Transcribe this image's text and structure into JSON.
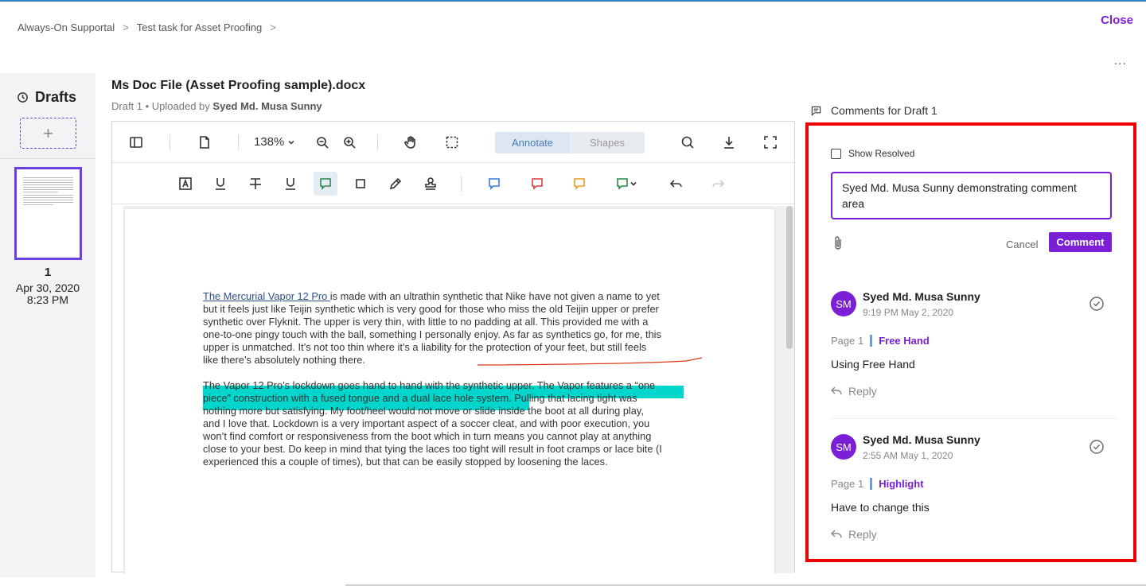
{
  "breadcrumb": {
    "items": [
      "Always-On Supportal",
      "Test task for Asset Proofing"
    ],
    "separator": ">"
  },
  "header": {
    "close_label": "Close",
    "more_label": "..."
  },
  "sidebar": {
    "title": "Drafts",
    "add_label": "+",
    "draft": {
      "number": "1",
      "date": "Apr 30, 2020",
      "time": "8:23 PM"
    }
  },
  "document": {
    "title": "Ms Doc File (Asset Proofing sample).docx",
    "subtitle_prefix": "Draft 1 • Uploaded by",
    "uploader": "Syed Md. Musa Sunny"
  },
  "toolbar": {
    "zoom": "138%",
    "mode_tabs": [
      {
        "label": "Annotate",
        "active": true
      },
      {
        "label": "Shapes",
        "active": false
      }
    ]
  },
  "page_content": {
    "para1_link": "The Mercurial Vapor 12 Pro ",
    "para1_lines": [
      "is made with an ultrathin synthetic that Nike have not given a name to yet",
      "but it feels just like Teijin synthetic which is very good for those who miss the old Teijin upper or prefer",
      "synthetic over Flyknit. The upper is very thin, with little to no padding at all. This provided me with a",
      "one-to-one pingy touch with the ball, something I personally enjoy. As far as synthetics go, for me, this",
      "upper is unmatched. It’s not too thin where it’s a liability for the protection of your feet, but still feels",
      "like there’s absolutely nothing there."
    ],
    "para2_lines": [
      "The Vapor 12 Pro’s lockdown goes hand to hand with the synthetic upper. The Vapor features a “one",
      "piece” construction with a fused tongue and a dual lace hole system. Pulling that lacing tight was",
      "nothing more but satisfying. My foot/heel would not move or slide inside the boot at all during play,",
      "and I love that. Lockdown is a very important aspect of a soccer cleat, and with poor execution, you",
      "won’t find comfort or responsiveness from the boot which in turn means you cannot play at anything",
      "close to your best. Do keep in mind that tying the laces too tight will result in foot cramps or lace bite (I",
      "experienced this a couple of times), but that can be easily stopped by loosening the laces."
    ]
  },
  "comments": {
    "heading": "Comments for Draft 1",
    "show_resolved_label": "Show Resolved",
    "input_value": "Syed Md. Musa Sunny demonstrating comment area",
    "cancel_label": "Cancel",
    "submit_label": "Comment",
    "threads": [
      {
        "initials": "SM",
        "author": "Syed Md. Musa Sunny",
        "time": "9:19 PM May 2, 2020",
        "page": "Page 1",
        "type": "Free Hand",
        "text": "Using Free Hand",
        "reply_label": "Reply"
      },
      {
        "initials": "SM",
        "author": "Syed Md. Musa Sunny",
        "time": "2:55 AM May 1, 2020",
        "page": "Page 1",
        "type": "Highlight",
        "text": "Have to change this",
        "reply_label": "Reply"
      }
    ]
  },
  "colors": {
    "accent": "#7b1fd6",
    "highlight": "#00d6cc",
    "frame": "#e00000",
    "freehand": "#d93a1a"
  }
}
